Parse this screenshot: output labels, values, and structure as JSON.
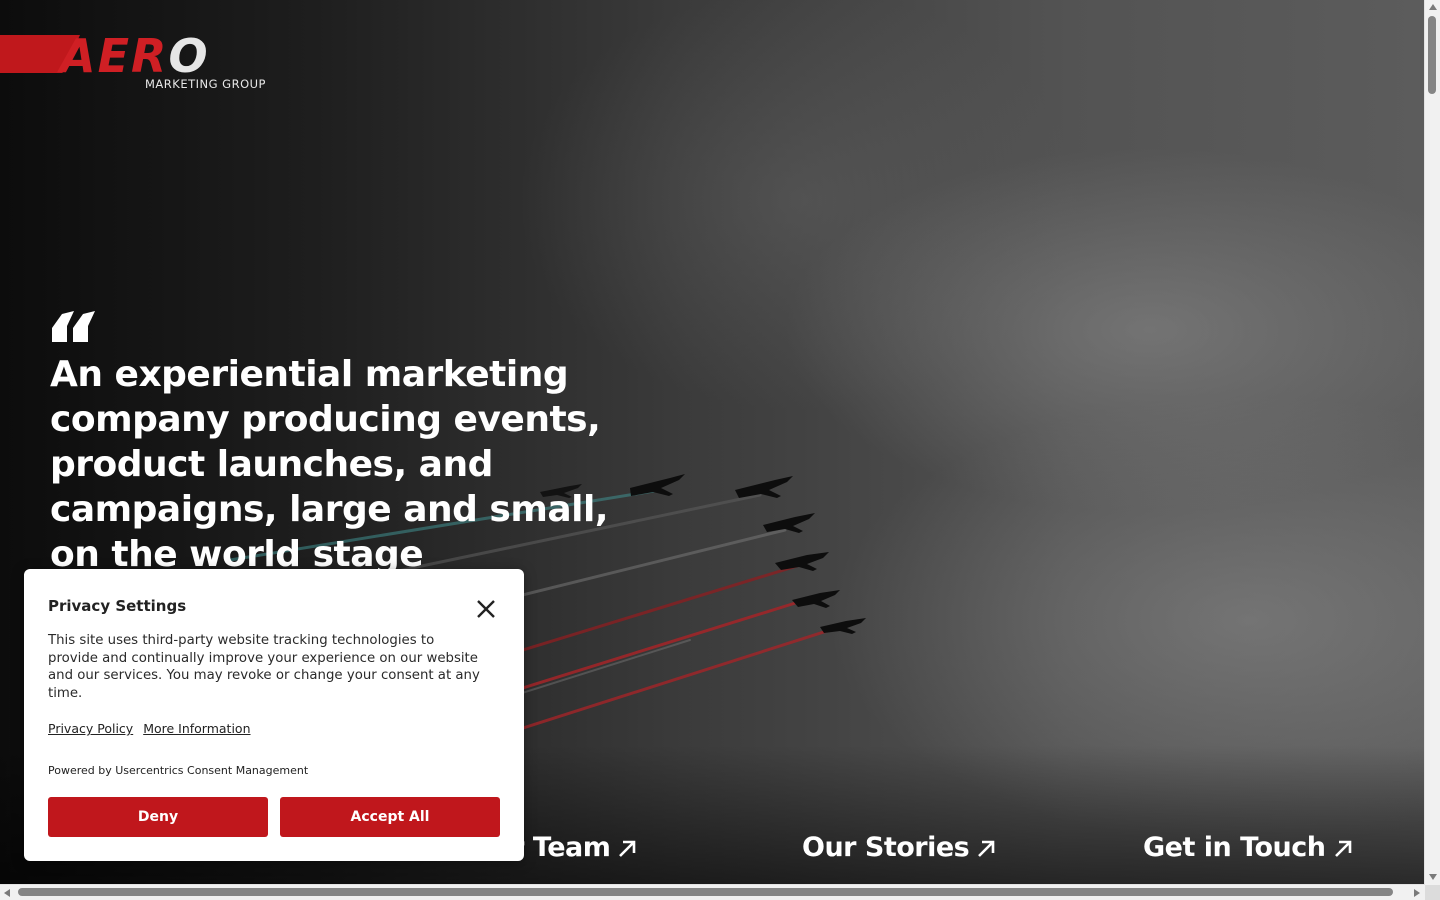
{
  "brand": {
    "logo_word": "AER",
    "logo_word_o": "O",
    "logo_tagline": "MARKETING GROUP",
    "accent_color": "#c0181c"
  },
  "hero": {
    "headline": "An experiential marketing company producing events, product launches, and campaigns, large and small, on the world stage",
    "quote_icon": "quote-mark-icon",
    "background_image": "aircraft formation flying with red, white and blue smoke trails"
  },
  "nav": {
    "team": "Our Team",
    "stories": "Our Stories",
    "contact": "Get in Touch",
    "arrow_icon": "arrow-up-right-icon"
  },
  "consent": {
    "title": "Privacy Settings",
    "body": "This site uses third-party website tracking technologies to provide and continually improve your experience on our website and our services. You may revoke or change your consent at any time.",
    "privacy_policy": "Privacy Policy",
    "more_information": "More Information",
    "powered_by": "Powered by Usercentrics Consent Management",
    "deny": "Deny",
    "accept_all": "Accept All",
    "button_color": "#c0171c"
  }
}
